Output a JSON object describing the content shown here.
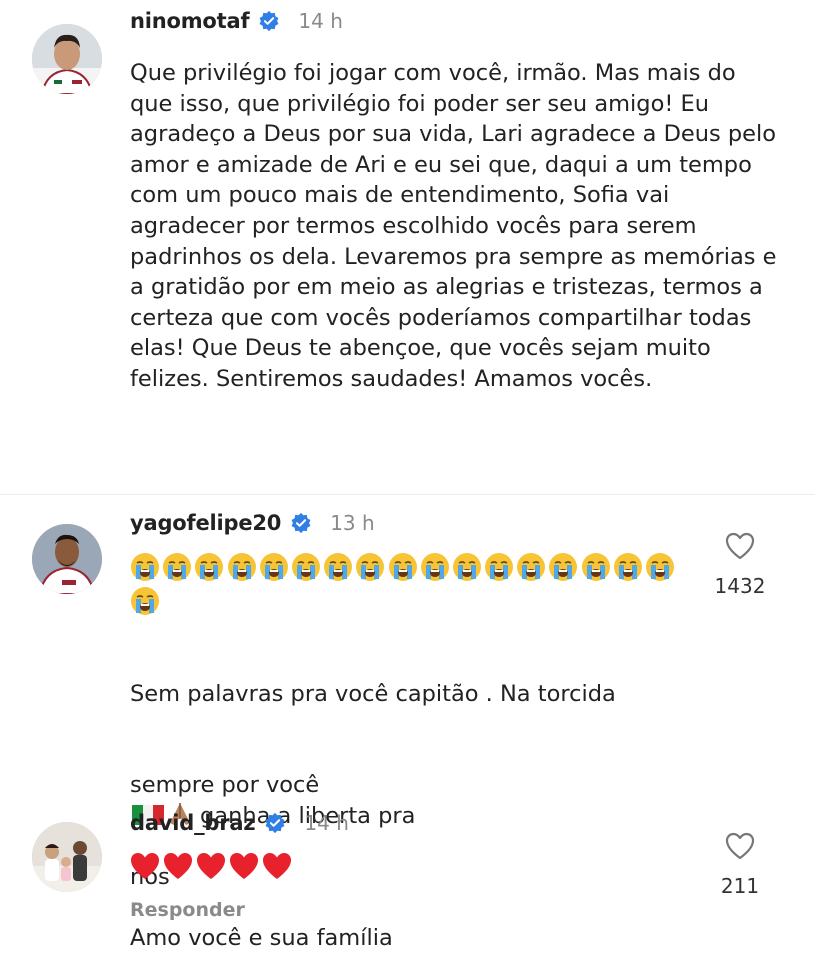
{
  "comments": [
    {
      "username": "ninomotaf",
      "time": "14 h",
      "text": "Que privilégio foi jogar com você, irmão. Mas mais do que isso, que privilégio foi poder ser seu amigo! Eu agradeço a Deus por sua vida, Lari agradece a Deus pelo amor e amizade de Ari e eu sei que, daqui a um tempo com um pouco mais de entendimento, Sofia vai agradecer por termos escolhido vocês para serem padrinhos os dela. Levaremos pra sempre as memórias e a gratidão por em meio as alegrias e tristezas, termos a certeza que com vocês poderíamos compartilhar todas elas! Que Deus te abençoe, que vocês sejam muito felizes. Sentiremos saudades! Amamos vocês."
    },
    {
      "username": "yagofelipe20",
      "time": "13 h",
      "emoji": "😭",
      "emoji_count": 18,
      "likes": "1432",
      "text_line1": "Sem palavras pra você capitão . Na torcida",
      "text_line2_before": "sempre por você",
      "text_line2_after": "ganha a liberta pra",
      "text_line3": "nós",
      "text_line4": "Amo você e sua família"
    },
    {
      "username": "david_braz",
      "time": "14 h",
      "emoji": "❤️",
      "emoji_count": 5,
      "likes": "211",
      "reply_label": "Responder"
    }
  ],
  "colors": {
    "verified_blue": "#2f7fe6",
    "muted_gray": "#8a8a8a",
    "heart_red": "#e8222c"
  }
}
